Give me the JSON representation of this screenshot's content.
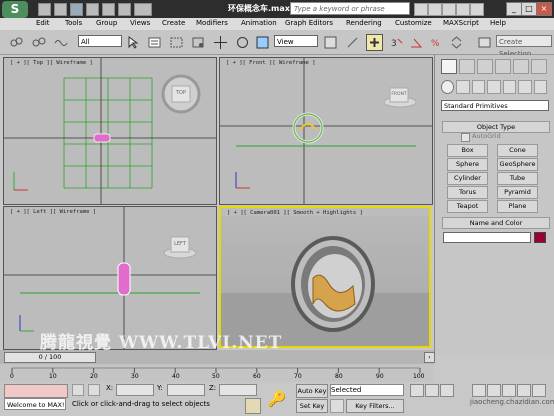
{
  "titlebar": {
    "document_title": "环保概念车.max",
    "search_placeholder": "Type a keyword or phrase"
  },
  "menu": [
    "Edit",
    "Tools",
    "Group",
    "Views",
    "Create",
    "Modifiers",
    "Animation",
    "Graph Editors",
    "Rendering",
    "Customize",
    "MAXScript",
    "Help"
  ],
  "toolbar": {
    "selection_filter": "All",
    "reference_coord": "View",
    "named_selection": "Create Selection"
  },
  "viewports": {
    "top": "[ + ][ Top ][ Wireframe ]",
    "front": "[ + ][ Front ][ Wireframe ]",
    "left": "[ + ][ Left ][ Wireframe ]",
    "camera": "[ + ][ Camera001 ][ Smooth + Highlights ]",
    "viewcube_top": "TOP",
    "viewcube_front": "FRONT",
    "viewcube_left": "LEFT"
  },
  "command_panel": {
    "category": "Standard Primitives",
    "object_type_header": "Object Type",
    "autogrid_label": "AutoGrid",
    "buttons": [
      "Box",
      "Cone",
      "Sphere",
      "GeoSphere",
      "Cylinder",
      "Tube",
      "Torus",
      "Pyramid",
      "Teapot",
      "Plane"
    ],
    "name_color_header": "Name and Color",
    "object_color": "#990033"
  },
  "timeline": {
    "slider_label": "0 / 100",
    "ticks": [
      "0",
      "10",
      "20",
      "30",
      "40",
      "50",
      "60",
      "70",
      "80",
      "90",
      "100"
    ]
  },
  "status": {
    "listener_text": "Welcome to MAX!",
    "prompt_text": "Click or click-and-drag to select objects",
    "x_label": "X:",
    "y_label": "Y:",
    "z_label": "Z:",
    "auto_key": "Auto Key",
    "set_key": "Set Key",
    "selected_dropdown": "Selected",
    "key_filters": "Key Filters..."
  },
  "watermark": "腾龍視覺 WWW.TLVI.NET",
  "watermark2": "jiaocheng.chazidian.com"
}
